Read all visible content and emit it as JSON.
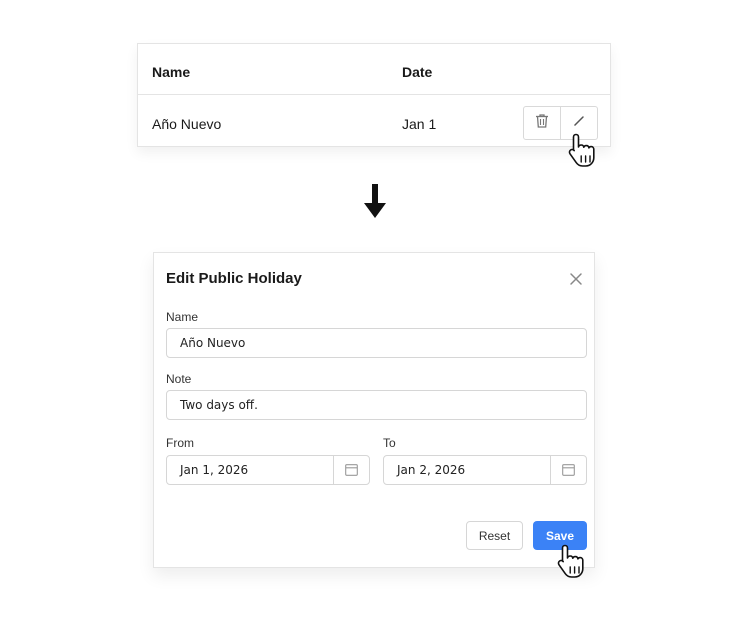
{
  "table": {
    "headers": {
      "name": "Name",
      "date": "Date"
    },
    "rows": [
      {
        "name": "Año Nuevo",
        "date": "Jan 1"
      }
    ]
  },
  "dialog": {
    "title": "Edit Public Holiday",
    "fields": {
      "name": {
        "label": "Name",
        "value": "Año Nuevo"
      },
      "note": {
        "label": "Note",
        "value": "Two days off."
      },
      "from": {
        "label": "From",
        "value": "Jan 1, 2026"
      },
      "to": {
        "label": "To",
        "value": "Jan 2, 2026"
      }
    },
    "buttons": {
      "reset": "Reset",
      "save": "Save"
    }
  },
  "icons": {
    "delete": "trash-icon",
    "edit": "pencil-icon",
    "flow": "arrow-down-icon",
    "close": "close-icon",
    "calendar": "calendar-icon",
    "cursor": "hand-pointer-icon"
  },
  "colors": {
    "accent": "#3b82f6",
    "border": "#d6d6d6"
  }
}
